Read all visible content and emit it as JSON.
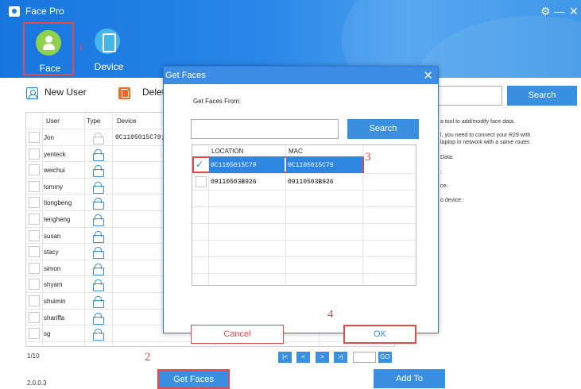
{
  "app": {
    "title": "Face Pro",
    "version": "2.0.0.3"
  },
  "window_controls": {
    "settings": "⚙",
    "minimize": "—",
    "close": "✕"
  },
  "nav": {
    "face_label": "Face",
    "device_label": "Device"
  },
  "annotations": {
    "a1": "1",
    "a2": "2",
    "a3": "3",
    "a4": "4"
  },
  "toolbar": {
    "new_user": "New User",
    "delete": "Delete"
  },
  "table": {
    "headers": {
      "user": "User",
      "type": "Type",
      "device": "Device"
    },
    "rows": [
      {
        "user": "Jon",
        "device": "0C1105015C79;"
      },
      {
        "user": "yenteck",
        "device": ""
      },
      {
        "user": "weichui",
        "device": ""
      },
      {
        "user": "tommy",
        "device": ""
      },
      {
        "user": "tiongbeng",
        "device": ""
      },
      {
        "user": "tengheng",
        "device": ""
      },
      {
        "user": "susan",
        "device": ""
      },
      {
        "user": "stacy",
        "device": ""
      },
      {
        "user": "simon",
        "device": ""
      },
      {
        "user": "shyam",
        "device": ""
      },
      {
        "user": "shuimin",
        "device": ""
      },
      {
        "user": "shariffa",
        "device": ""
      },
      {
        "user": "sg",
        "device": ""
      }
    ]
  },
  "pagination": {
    "info": "1/10",
    "first": "|<",
    "prev": "<",
    "next": ">",
    "last": ">|",
    "go": "GO"
  },
  "bottom": {
    "get_faces": "Get Faces",
    "add_to": "Add To"
  },
  "right_panel": {
    "search": "Search",
    "line1": "a tool to add/modify face data.",
    "line2": "l, you need to connect your R29 with",
    "line3": "laptop in network with a same router.",
    "line4": "Data:",
    "line5": ":",
    "line6": "ce:",
    "line7": "o device:"
  },
  "dialog": {
    "title": "Get Faces",
    "close": "✕",
    "from_label": "Get Faces From:",
    "search": "Search",
    "col_location": "LOCATION",
    "col_mac": "MAC",
    "rows": [
      {
        "location": "0C1105015C79",
        "mac": "0C1105015C79",
        "checked": true
      },
      {
        "location": "09110503B926",
        "mac": "09110503B926",
        "checked": false
      }
    ],
    "check_glyph": "✓",
    "cancel": "Cancel",
    "ok": "OK"
  },
  "colors": {
    "accent": "#3a8fe0",
    "highlight_red": "#e34b4b",
    "header_blue": "#1e7ee4"
  }
}
